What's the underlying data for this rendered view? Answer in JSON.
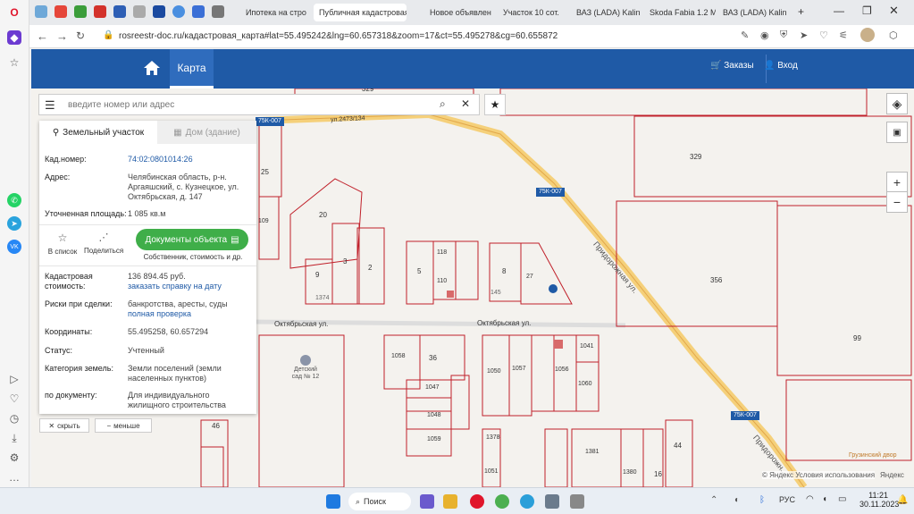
{
  "browser": {
    "tabs": [
      {
        "label": "Ипотека на стро"
      },
      {
        "label": "Публичная кадастровая"
      },
      {
        "label": "Новое объявлен"
      },
      {
        "label": "Участок 10 сот."
      },
      {
        "label": "ВАЗ (LADA) Kalin"
      },
      {
        "label": "Skoda Fabia 1.2 M"
      },
      {
        "label": "ВАЗ (LADA) Kalin"
      }
    ],
    "url": "rosreestr-doc.ru/кадастровая_карта#lat=55.495242&lng=60.657318&zoom=17&ct=55.495278&cg=60.655872"
  },
  "site": {
    "nav_map": "Карта",
    "orders": "Заказы",
    "login": "Вход"
  },
  "search": {
    "placeholder": "введите номер или адрес"
  },
  "panel": {
    "tab_land": "Земельный участок",
    "tab_building": "Дом (здание)",
    "kad_label": "Кад.номер:",
    "kad_value": "74:02:0801014:26",
    "addr_label": "Адрес:",
    "addr_value": "Челябинская область, р-н. Аргаяшский, с. Кузнецкое, ул. Октябрьская, д. 147",
    "area_label": "Уточненная площадь:",
    "area_value": "1 085 кв.м",
    "btn_list": "В список",
    "btn_share": "Поделиться",
    "docs_button": "Документы объекта",
    "docs_sub": "Собственник, стоимость и др.",
    "cost_label": "Кадастровая стоимость:",
    "cost_value": "136 894.45 руб.",
    "cost_link": "заказать справку на дату",
    "risk_label": "Риски при сделки:",
    "risk_value": "банкротства, аресты, суды",
    "risk_link": "полная проверка",
    "coord_label": "Координаты:",
    "coord_value": "55.495258, 60.657294",
    "status_label": "Статус:",
    "status_value": "Учтенный",
    "cat_label": "Категория земель:",
    "cat_value": "Земли поселений (земли населенных пунктов)",
    "doc_label": "по документу:",
    "doc_value": "Для индивидуального жилищного строительства",
    "hide": "скрыть",
    "less": "меньше"
  },
  "map": {
    "labels": {
      "street_top": "ул.2473/134",
      "road1": "75К-007",
      "road2": "75К-007",
      "road3": "75К-007",
      "pridorozh1": "Придорожная ул.",
      "pridorozh2": "Придорожн...",
      "oktyabr1": "Октябрьская ул.",
      "oktyabr2": "Октябрьская ул.",
      "p329a": "329",
      "p329b": "329",
      "p356": "356",
      "p99": "99",
      "p20": "20",
      "p3": "3",
      "p2": "2",
      "p9": "9",
      "p5": "5",
      "p8": "8",
      "p27": "27",
      "p118": "118",
      "p110": "110",
      "p145": "145",
      "p1374": "1374",
      "p1058": "1058",
      "p36": "36",
      "p1047": "1047",
      "p1048": "1048",
      "p1059": "1059",
      "p1050": "1050",
      "p1057": "1057",
      "p1056": "1056",
      "p1060": "1060",
      "p1041": "1041",
      "p1378": "1378",
      "p1051": "1051",
      "p1381": "1381",
      "p1380": "1380",
      "p16": "16",
      "p44": "44",
      "p46": "46",
      "p25": "25",
      "p109": "109",
      "kindergarten": "Детский сад № 12",
      "grusin": "Грузинский двор",
      "copyright": "© Яндекс Условия использования",
      "yandex": "Яндекс"
    }
  },
  "taskbar": {
    "search": "Поиск",
    "lang": "РУС",
    "time": "11:21",
    "date": "30.11.2023"
  }
}
